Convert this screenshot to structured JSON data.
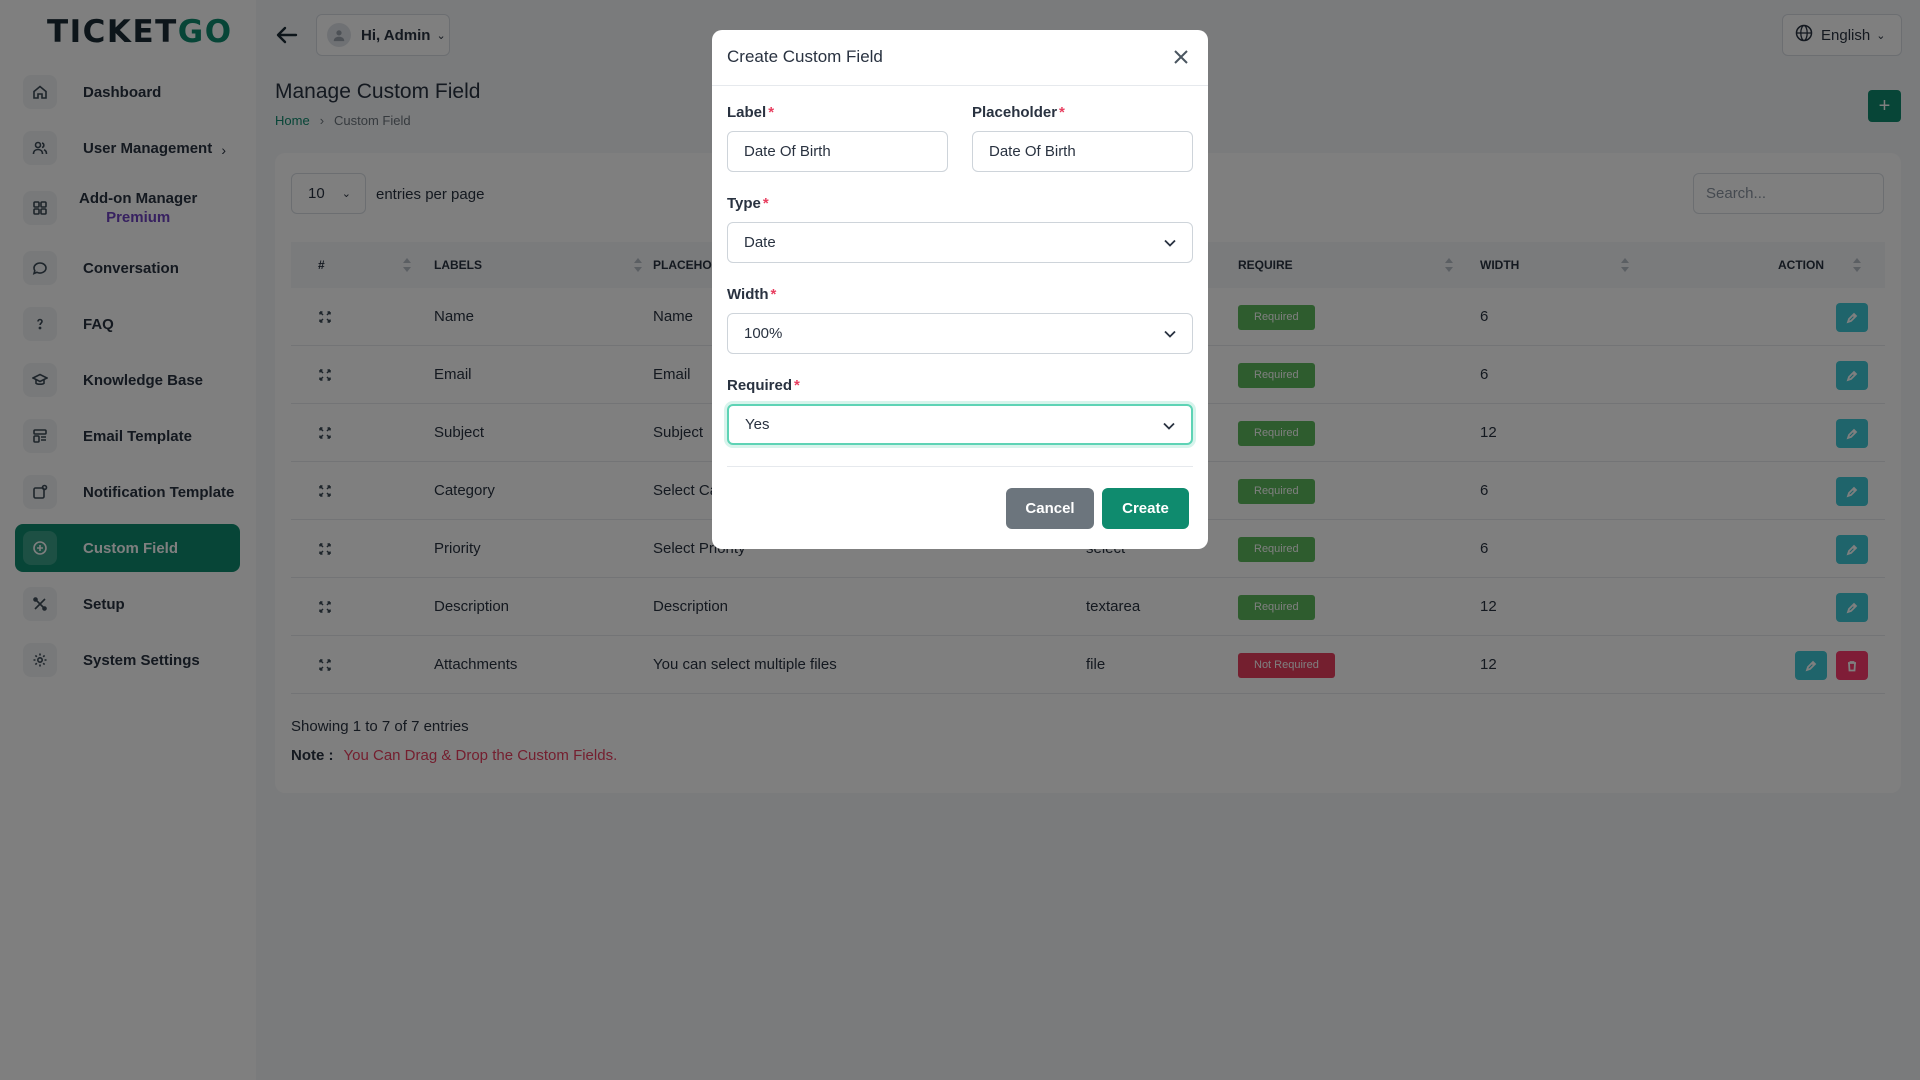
{
  "brand": {
    "logo_pre": "TICKET",
    "logo_post": "GO"
  },
  "sidebar": {
    "items": [
      {
        "label": "Dashboard"
      },
      {
        "label": "User Management"
      },
      {
        "label": "Add-on Manager",
        "sub": "Premium"
      },
      {
        "label": "Conversation"
      },
      {
        "label": "FAQ"
      },
      {
        "label": "Knowledge Base"
      },
      {
        "label": "Email Template"
      },
      {
        "label": "Notification Template"
      },
      {
        "label": "Custom Field"
      },
      {
        "label": "Setup"
      },
      {
        "label": "System Settings"
      }
    ]
  },
  "header": {
    "user": "Hi, Admin",
    "language": "English"
  },
  "page": {
    "title": "Manage Custom Field",
    "breadcrumb": {
      "home": "Home",
      "current": "Custom Field"
    }
  },
  "table": {
    "per_page": "10",
    "per_page_label": "entries per page",
    "search_placeholder": "Search...",
    "headers": {
      "num": "#",
      "labels": "LABELS",
      "placeholder": "PLACEHO",
      "require": "REQUIRE",
      "width": "WIDTH",
      "action": "ACTION"
    },
    "rows": [
      {
        "label": "Name",
        "placeholder": "Name",
        "type": "",
        "require": "Required",
        "width": "6"
      },
      {
        "label": "Email",
        "placeholder": "Email",
        "type": "",
        "require": "Required",
        "width": "6"
      },
      {
        "label": "Subject",
        "placeholder": "Subject",
        "type": "",
        "require": "Required",
        "width": "12"
      },
      {
        "label": "Category",
        "placeholder": "Select Ca",
        "type": "",
        "require": "Required",
        "width": "6"
      },
      {
        "label": "Priority",
        "placeholder": "Select Priority",
        "type": "select",
        "require": "Required",
        "width": "6"
      },
      {
        "label": "Description",
        "placeholder": "Description",
        "type": "textarea",
        "require": "Required",
        "width": "12"
      },
      {
        "label": "Attachments",
        "placeholder": "You can select multiple files",
        "type": "file",
        "require": "Not Required",
        "width": "12"
      }
    ],
    "showing": "Showing 1 to 7 of 7 entries",
    "note_label": "Note :",
    "note_text": "You Can Drag & Drop the Custom Fields."
  },
  "modal": {
    "title": "Create Custom Field",
    "label_field": {
      "label": "Label",
      "value": "Date Of Birth"
    },
    "placeholder_field": {
      "label": "Placeholder",
      "value": "Date Of Birth"
    },
    "type_field": {
      "label": "Type",
      "value": "Date"
    },
    "width_field": {
      "label": "Width",
      "value": "100%"
    },
    "required_field": {
      "label": "Required",
      "value": "Yes"
    },
    "required_marker": "*",
    "cancel": "Cancel",
    "create": "Create"
  }
}
